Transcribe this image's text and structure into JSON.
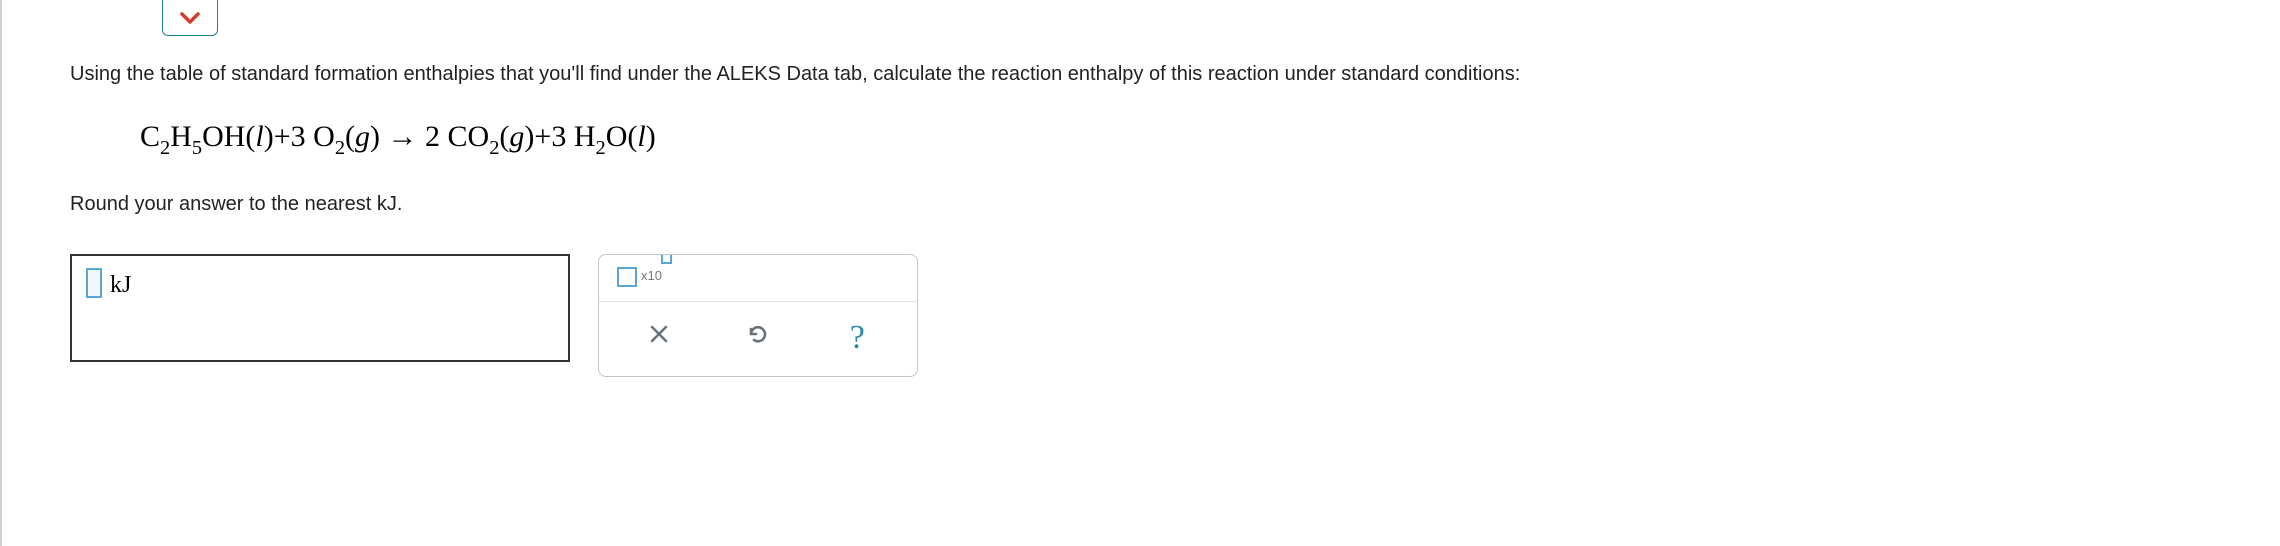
{
  "prompt": {
    "main": "Using the table of standard formation enthalpies that you'll find under the ALEKS Data tab, calculate the reaction enthalpy of this reaction under standard conditions:",
    "round": "Round your answer to the nearest kJ."
  },
  "equation": {
    "reactant1": {
      "formula": "C2H5OH",
      "state": "l"
    },
    "reactant2": {
      "coef": "3",
      "formula": "O2",
      "state": "g"
    },
    "product1": {
      "coef": "2",
      "formula": "CO2",
      "state": "g"
    },
    "product2": {
      "coef": "3",
      "formula": "H2O",
      "state": "l"
    }
  },
  "answer": {
    "value": "",
    "unit": "kJ"
  },
  "tools": {
    "sci_notation_label": "x10",
    "clear": "clear",
    "reset": "reset",
    "help": "?"
  },
  "icons": {
    "chevron": "chevron-down-icon",
    "clear": "close-icon",
    "reset": "undo-icon",
    "help": "help-icon"
  }
}
